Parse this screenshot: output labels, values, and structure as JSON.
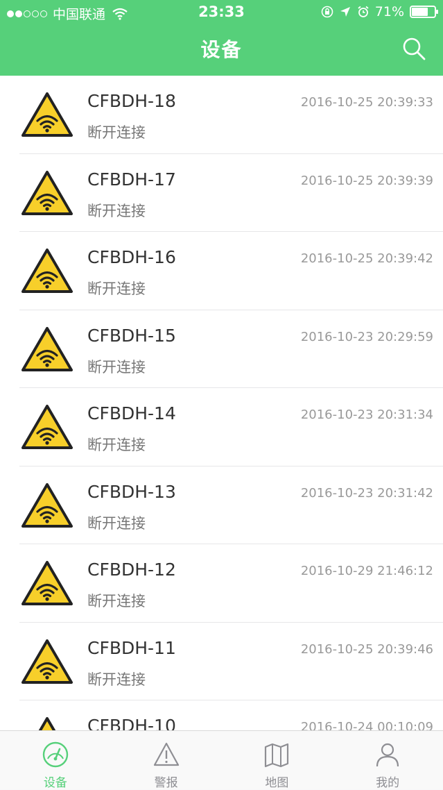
{
  "status_bar": {
    "carrier": "中国联通",
    "time": "23:33",
    "battery": "71%",
    "battery_level": 0.71
  },
  "nav": {
    "title": "设备",
    "search_icon": "search-icon"
  },
  "devices": [
    {
      "name": "CFBDH-18",
      "status": "断开连接",
      "time": "2016-10-25 20:39:33"
    },
    {
      "name": "CFBDH-17",
      "status": "断开连接",
      "time": "2016-10-25 20:39:39"
    },
    {
      "name": "CFBDH-16",
      "status": "断开连接",
      "time": "2016-10-25 20:39:42"
    },
    {
      "name": "CFBDH-15",
      "status": "断开连接",
      "time": "2016-10-23 20:29:59"
    },
    {
      "name": "CFBDH-14",
      "status": "断开连接",
      "time": "2016-10-23 20:31:34"
    },
    {
      "name": "CFBDH-13",
      "status": "断开连接",
      "time": "2016-10-23 20:31:42"
    },
    {
      "name": "CFBDH-12",
      "status": "断开连接",
      "time": "2016-10-29 21:46:12"
    },
    {
      "name": "CFBDH-11",
      "status": "断开连接",
      "time": "2016-10-25 20:39:46"
    },
    {
      "name": "CFBDH-10",
      "status": "",
      "time": "2016-10-24 00:10:09"
    }
  ],
  "tabs": [
    {
      "label": "设备",
      "icon": "gauge-icon",
      "active": true
    },
    {
      "label": "警报",
      "icon": "warning-icon",
      "active": false
    },
    {
      "label": "地图",
      "icon": "map-icon",
      "active": false
    },
    {
      "label": "我的",
      "icon": "user-icon",
      "active": false
    }
  ],
  "colors": {
    "accent": "#56d07a",
    "warning_yellow": "#f7cf2a",
    "tab_inactive": "#8e8e93"
  }
}
